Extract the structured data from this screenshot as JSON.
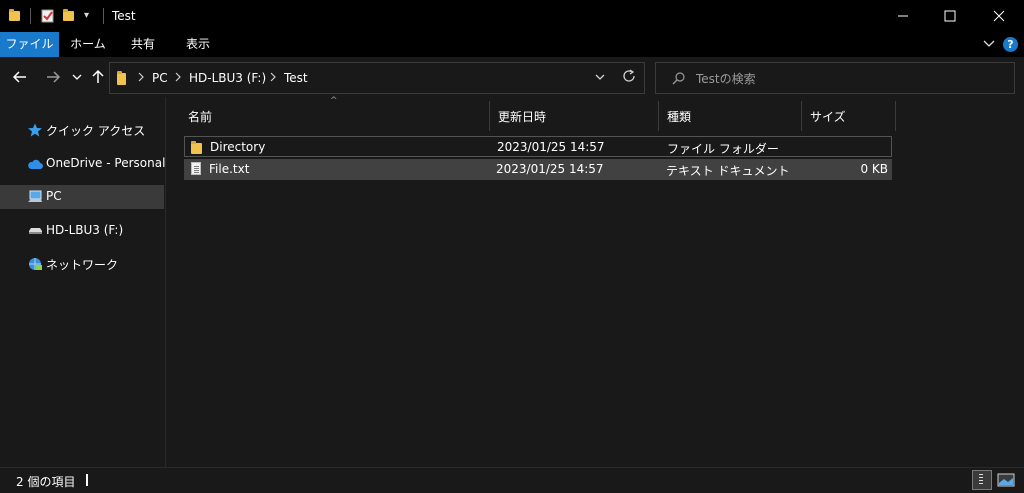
{
  "window": {
    "title": "Test",
    "minimize_label": "─",
    "maximize_label": "☐",
    "close_label": "✕"
  },
  "ribbon": {
    "tabs": [
      "ファイル",
      "ホーム",
      "共有",
      "表示"
    ],
    "chevron_label": "∨",
    "help_label": "?"
  },
  "nav": {
    "back_label": "←",
    "forward_label": "→",
    "recent_label": "∨",
    "up_label": "↑",
    "breadcrumbs": [
      "PC",
      "HD-LBU3 (F:)",
      "Test"
    ],
    "separator": ">",
    "dropdown_label": "∨",
    "refresh_label": "↻",
    "search_placeholder": "Testの検索"
  },
  "sidebar": {
    "items": [
      {
        "label": "クイック アクセス",
        "icon": "star-icon"
      },
      {
        "label": "OneDrive - Personal",
        "icon": "cloud-icon"
      },
      {
        "label": "PC",
        "icon": "pc-icon"
      },
      {
        "label": "HD-LBU3 (F:)",
        "icon": "drive-icon"
      },
      {
        "label": "ネットワーク",
        "icon": "network-icon"
      }
    ],
    "selected_index": 2
  },
  "file_list": {
    "columns": [
      "名前",
      "更新日時",
      "種類",
      "サイズ"
    ],
    "sort_indicator": "^",
    "rows": [
      {
        "name": "Directory",
        "modified": "2023/01/25 14:57",
        "type": "ファイル フォルダー",
        "size": "",
        "icon": "folder-icon"
      },
      {
        "name": "File.txt",
        "modified": "2023/01/25 14:57",
        "type": "テキスト ドキュメント",
        "size": "0 KB",
        "icon": "text-file-icon"
      }
    ]
  },
  "status": {
    "item_count": "2 個の項目"
  },
  "colors": {
    "accent": "#1979ca",
    "background": "#191919",
    "titlebar": "#000000",
    "folder": "#f2c24f",
    "selection": "#414141"
  }
}
